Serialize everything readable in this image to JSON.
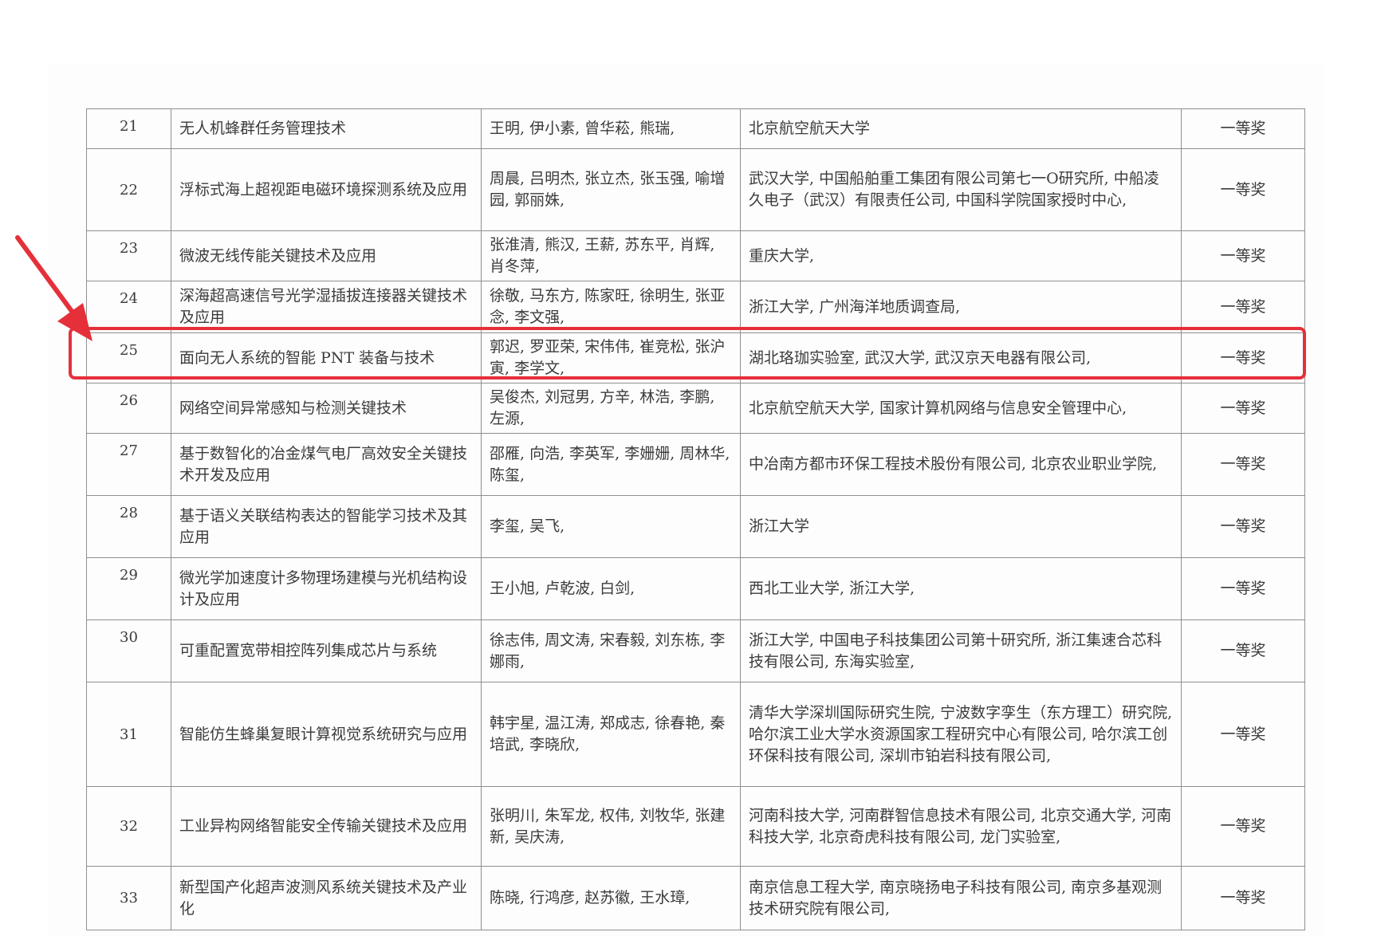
{
  "colors": {
    "highlight": "#e5303a",
    "grid": "#8f8f8f",
    "text": "#3b3b3b"
  },
  "highlight": {
    "row_index": 4,
    "arrow_icon": "red-arrow-icon"
  },
  "rows": [
    {
      "no": "21",
      "title": "无人机蜂群任务管理技术",
      "people": "王明, 伊小素, 曾华菘, 熊瑞,",
      "org": "北京航空航天大学",
      "level": "一等奖"
    },
    {
      "no": "22",
      "title": "浮标式海上超视距电磁环境探测系统及应用",
      "people": "周晨, 吕明杰, 张立杰, 张玉强, 喻增园, 郭丽姝,",
      "org": "武汉大学, 中国船舶重工集团有限公司第七一O研究所, 中船凌久电子（武汉）有限责任公司, 中国科学院国家授时中心,",
      "level": "一等奖"
    },
    {
      "no": "23",
      "title": "微波无线传能关键技术及应用",
      "people": "张淮清, 熊汉, 王薪, 苏东平, 肖辉, 肖冬萍,",
      "org": "重庆大学,",
      "level": "一等奖"
    },
    {
      "no": "24",
      "title": "深海超高速信号光学湿插拔连接器关键技术及应用",
      "people": "徐敬, 马东方, 陈家旺, 徐明生, 张亚念, 李文强,",
      "org": "浙江大学, 广州海洋地质调查局,",
      "level": "一等奖"
    },
    {
      "no": "25",
      "title": "面向无人系统的智能 PNT 装备与技术",
      "people": "郭迟, 罗亚荣, 宋伟伟, 崔竞松, 张沪寅, 李学文,",
      "org": "湖北珞珈实验室, 武汉大学, 武汉京天电器有限公司,",
      "level": "一等奖"
    },
    {
      "no": "26",
      "title": "网络空间异常感知与检测关键技术",
      "people": "吴俊杰, 刘冠男, 方辛, 林浩, 李鹏, 左源,",
      "org": "北京航空航天大学, 国家计算机网络与信息安全管理中心,",
      "level": "一等奖"
    },
    {
      "no": "27",
      "title": "基于数智化的冶金煤气电厂高效安全关键技术开发及应用",
      "people": "邵雁, 向浩, 李英军, 李姗姗, 周林华, 陈玺,",
      "org": "中冶南方都市环保工程技术股份有限公司, 北京农业职业学院,",
      "level": "一等奖"
    },
    {
      "no": "28",
      "title": "基于语义关联结构表达的智能学习技术及其应用",
      "people": "李玺, 吴飞,",
      "org": "浙江大学",
      "level": "一等奖"
    },
    {
      "no": "29",
      "title": "微光学加速度计多物理场建模与光机结构设计及应用",
      "people": "王小旭, 卢乾波, 白剑,",
      "org": "西北工业大学, 浙江大学,",
      "level": "一等奖"
    },
    {
      "no": "30",
      "title": "可重配置宽带相控阵列集成芯片与系统",
      "people": "徐志伟, 周文涛, 宋春毅, 刘东栋, 李娜雨,",
      "org": "浙江大学, 中国电子科技集团公司第十研究所, 浙江集速合芯科技有限公司, 东海实验室,",
      "level": "一等奖"
    },
    {
      "no": "31",
      "title": "智能仿生蜂巢复眼计算视觉系统研究与应用",
      "people": "韩宇星, 温江涛, 郑成志, 徐春艳, 秦培武, 李晓欣,",
      "org": "清华大学深圳国际研究生院, 宁波数字孪生（东方理工）研究院, 哈尔滨工业大学水资源国家工程研究中心有限公司, 哈尔滨工创环保科技有限公司, 深圳市铂岩科技有限公司,",
      "level": "一等奖"
    },
    {
      "no": "32",
      "title": "工业异构网络智能安全传输关键技术及应用",
      "people": "张明川, 朱军龙, 权伟, 刘牧华, 张建新, 吴庆涛,",
      "org": "河南科技大学, 河南群智信息技术有限公司, 北京交通大学, 河南科技大学, 北京奇虎科技有限公司, 龙门实验室,",
      "level": "一等奖"
    },
    {
      "no": "33",
      "title": "新型国产化超声波测风系统关键技术及产业化",
      "people": "陈晓, 行鸿彦, 赵苏徽, 王水璋,",
      "org": "南京信息工程大学, 南京晓扬电子科技有限公司, 南京多基观测技术研究院有限公司,",
      "level": "一等奖"
    }
  ]
}
